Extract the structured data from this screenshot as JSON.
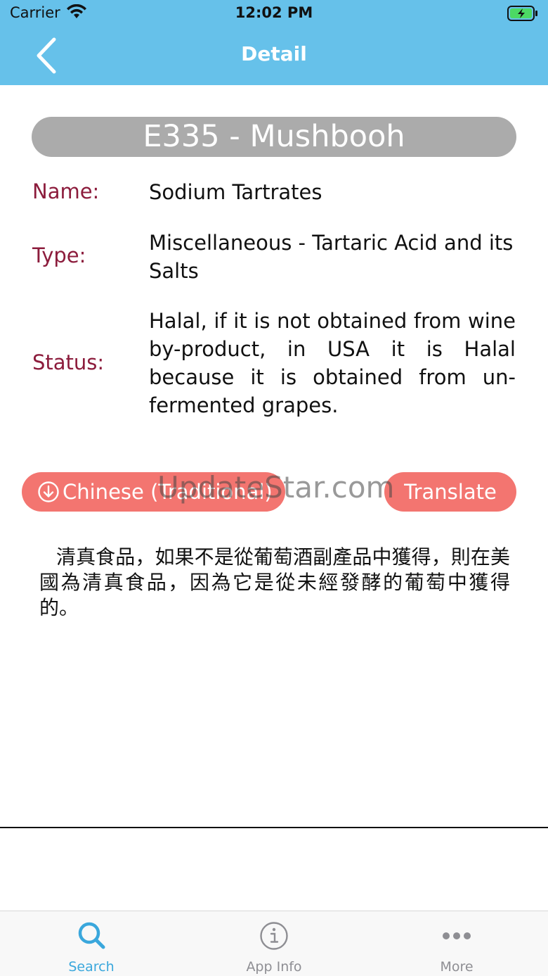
{
  "status_bar": {
    "carrier": "Carrier",
    "time": "12:02 PM"
  },
  "nav": {
    "title": "Detail"
  },
  "additive": {
    "heading": "E335 - Mushbooh",
    "name_label": "Name:",
    "name_value": "Sodium Tartrates",
    "type_label": "Type:",
    "type_value": "Miscellaneous - Tartaric Acid and its Salts",
    "status_label": "Status:",
    "status_value": "Halal, if it is not obtained from wine by-product, in USA it is Halal because it is obtained from un-fermented grapes."
  },
  "translate": {
    "language": "Chinese (Traditional)",
    "button_label": "Translate",
    "result": "清真食品，如果不是從葡萄酒副產品中獲得，則在美國為清真食品，因為它是從未經發酵的葡萄中獲得的。"
  },
  "watermark": "UpdateStar.com",
  "tabs": [
    {
      "label": "Search",
      "icon": "search-icon",
      "active": true
    },
    {
      "label": "App Info",
      "icon": "info-icon",
      "active": false
    },
    {
      "label": "More",
      "icon": "more-icon",
      "active": false
    }
  ],
  "colors": {
    "nav": "#66c1ea",
    "label": "#8c1c3c",
    "button": "#f37570",
    "pill": "#ababab",
    "tab_active": "#3aa7dc"
  }
}
